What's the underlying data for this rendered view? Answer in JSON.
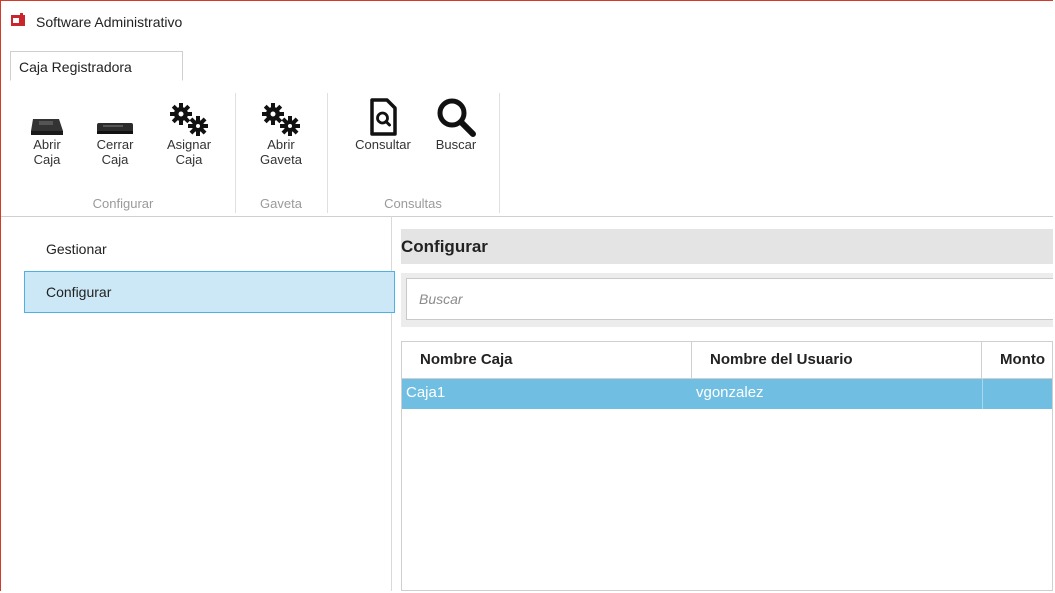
{
  "window": {
    "title": "Software Administrativo"
  },
  "tabs": [
    {
      "label": "Caja Registradora"
    }
  ],
  "ribbon": {
    "groups": [
      {
        "label": "Configurar",
        "buttons": [
          {
            "line1": "Abrir",
            "line2": "Caja",
            "icon": "cash-register-icon"
          },
          {
            "line1": "Cerrar",
            "line2": "Caja",
            "icon": "cash-register-icon"
          },
          {
            "line1": "Asignar",
            "line2": "Caja",
            "icon": "gears-icon"
          }
        ]
      },
      {
        "label": "Gaveta",
        "buttons": [
          {
            "line1": "Abrir",
            "line2": "Gaveta",
            "icon": "gears-icon"
          }
        ]
      },
      {
        "label": "Consultas",
        "buttons": [
          {
            "line1": "Consultar",
            "line2": "",
            "icon": "document-search-icon"
          },
          {
            "line1": "Buscar",
            "line2": "",
            "icon": "search-icon"
          }
        ]
      }
    ]
  },
  "sidebar": {
    "items": [
      {
        "label": "Gestionar"
      },
      {
        "label": "Configurar"
      }
    ]
  },
  "content": {
    "title": "Configurar",
    "search": {
      "placeholder": "Buscar",
      "value": ""
    },
    "table": {
      "columns": [
        "Nombre Caja",
        "Nombre del Usuario",
        "Monto"
      ],
      "rows": [
        [
          "Caja1",
          "vgonzalez",
          ""
        ]
      ]
    }
  },
  "colors": {
    "selection": "#70bfe3",
    "nav_active": "#cce8f6",
    "frame_border": "#d23a2a"
  }
}
